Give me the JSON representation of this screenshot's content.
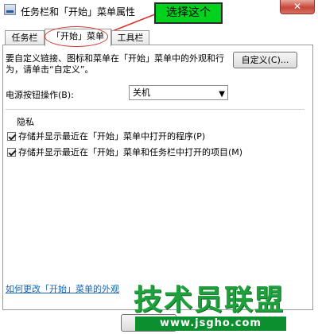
{
  "window": {
    "title": "任务栏和「开始」菜单属性",
    "close_label": "✕"
  },
  "annotation": {
    "text": "选择这个",
    "box_color": "#00d21e",
    "circle_color": "#d8322b"
  },
  "tabs": [
    {
      "label": "任务栏"
    },
    {
      "label": "「开始」菜单"
    },
    {
      "label": "工具栏"
    }
  ],
  "panel": {
    "description": "要自定义链接、图标和菜单在「开始」菜单中的外观和行为，请单击“自定义”。",
    "customize_button": "自定义(C)...",
    "power_label": "电源按钮操作(B):",
    "power_value": "关机",
    "privacy_title": "隐私",
    "privacy_items": [
      {
        "label": "存储并显示最近在「开始」菜单中打开的程序(P)",
        "checked": true
      },
      {
        "label": "存储并显示最近在「开始」菜单和任务栏中打开的项目(M)",
        "checked": true
      }
    ],
    "help_link": "如何更改「开始」菜单的外观"
  },
  "watermark": {
    "text": "技术员联盟",
    "url": "www.jsgho.com",
    "color": "#1ea13d"
  }
}
